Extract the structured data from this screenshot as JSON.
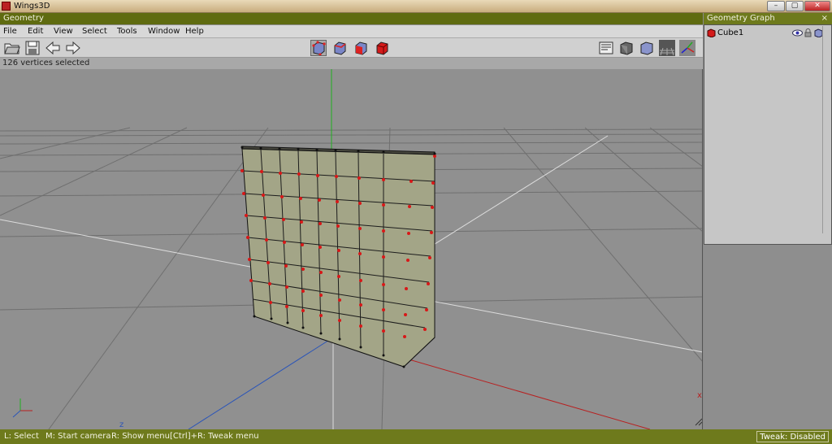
{
  "window": {
    "title": "Wings3D",
    "min_label": "–",
    "max_label": "▢",
    "close_label": "✕"
  },
  "geometry_window": {
    "title": "Geometry",
    "close_label": "×"
  },
  "menu": [
    "File",
    "Edit",
    "View",
    "Select",
    "Tools",
    "Window",
    "Help"
  ],
  "status_line": "126 vertices selected",
  "side_panel": {
    "title": "Geometry Graph",
    "close_label": "×",
    "object_name": "Cube1"
  },
  "viewport": {
    "axis_z_label": "z",
    "axis_x_label": "x"
  },
  "bottom": {
    "hint1": "L: Select",
    "hint2": "M: Start camera",
    "hint3": "R: Show menu",
    "hint4": "[Ctrl]+R: Tweak menu",
    "tweak": "Tweak: Disabled"
  },
  "colors": {
    "accent": "#6e7a1c",
    "selected_vertex": "#d81818",
    "mesh_face": "#9fa184"
  }
}
